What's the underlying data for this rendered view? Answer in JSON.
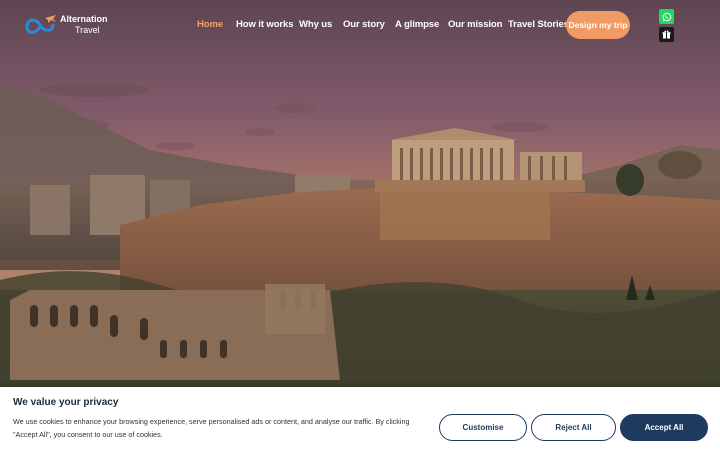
{
  "brand": {
    "name_line1": "Alternation",
    "name_line2": "Travel",
    "logo_icon": "infinity-plane-logo"
  },
  "nav": {
    "items": [
      {
        "label": "Home",
        "active": true
      },
      {
        "label": "How it works",
        "active": false
      },
      {
        "label": "Why us",
        "active": false
      },
      {
        "label": "Our story",
        "active": false
      },
      {
        "label": "A glimpse",
        "active": false
      },
      {
        "label": "Our mission",
        "active": false
      },
      {
        "label": "Travel Stories",
        "active": false
      }
    ],
    "cta_label": "Design my trip"
  },
  "floating": {
    "whatsapp_icon": "whatsapp-icon",
    "gift_icon": "gift-icon"
  },
  "hero": {
    "image_subject": "acropolis-sunset"
  },
  "cookie": {
    "title": "We value your privacy",
    "text": "We use cookies to enhance your browsing experience, serve personalised ads or content, and analyse our traffic. By clicking \"Accept All\", you consent to our use of cookies.",
    "customise_label": "Customise",
    "reject_label": "Reject All",
    "accept_label": "Accept All"
  },
  "colors": {
    "accent": "#f29a63",
    "active_nav": "#f4a264",
    "banner_button": "#1e3a5f",
    "whatsapp": "#25d366"
  }
}
